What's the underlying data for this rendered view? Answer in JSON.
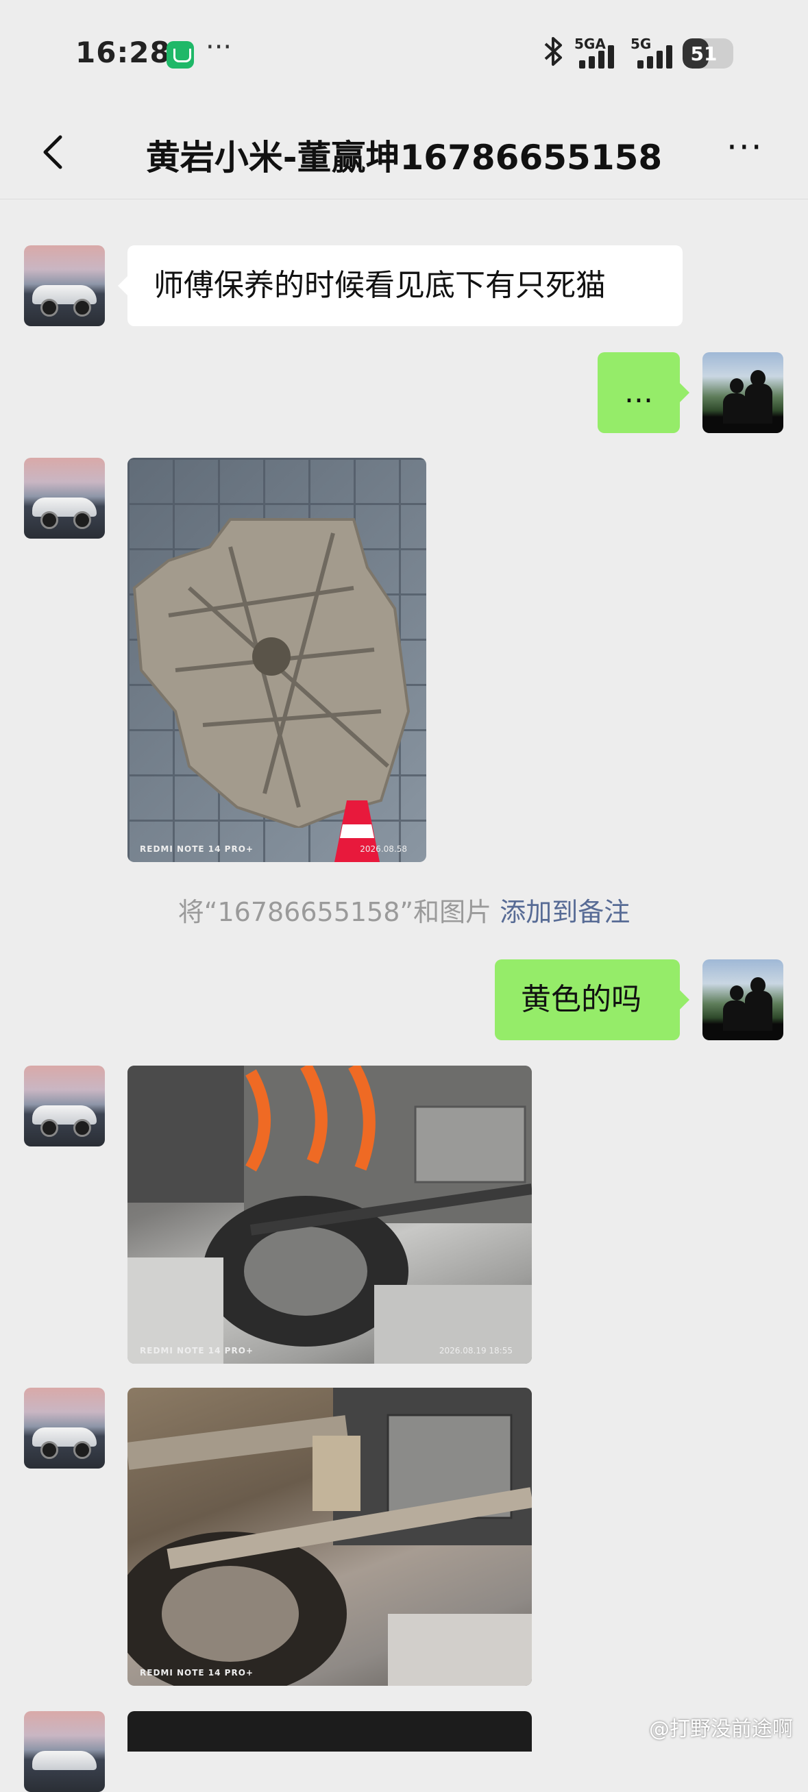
{
  "status_bar": {
    "time": "16:28",
    "more": "···",
    "network1": "5GA",
    "network2": "5G",
    "battery": "51",
    "battery_level": 0.51
  },
  "nav": {
    "back_icon": "chevron-left-icon",
    "title": "黄岩小米-董赢坤16786655158",
    "more": "···"
  },
  "messages": [
    {
      "from": "other",
      "type": "text",
      "text": "师傅保养的时候看见底下有只死猫"
    },
    {
      "from": "me",
      "type": "text",
      "text": "..."
    },
    {
      "from": "other",
      "type": "image",
      "subject": "underbody-shield",
      "watermark": "REDMI NOTE 14 PRO+",
      "date": "2026.08.58"
    },
    {
      "from": "system",
      "type": "tip",
      "text": "将“16786655158”和图片",
      "link": "添加到备注"
    },
    {
      "from": "me",
      "type": "text",
      "text": "黄色的吗"
    },
    {
      "from": "other",
      "type": "image",
      "subject": "car-underside",
      "watermark": "REDMI NOTE 14 PRO+",
      "date": "2026.08.19 18:55"
    },
    {
      "from": "other",
      "type": "image",
      "subject": "car-underside-suspension",
      "watermark": "REDMI NOTE 14 PRO+",
      "date": ""
    },
    {
      "from": "other",
      "type": "image",
      "subject": "black-bag",
      "watermark": "",
      "date": ""
    }
  ],
  "watermark": "@打野没前途啊",
  "colors": {
    "background": "#ededed",
    "bubble_out": "#95ec69",
    "bubble_in": "#ffffff",
    "link": "#576b95"
  }
}
